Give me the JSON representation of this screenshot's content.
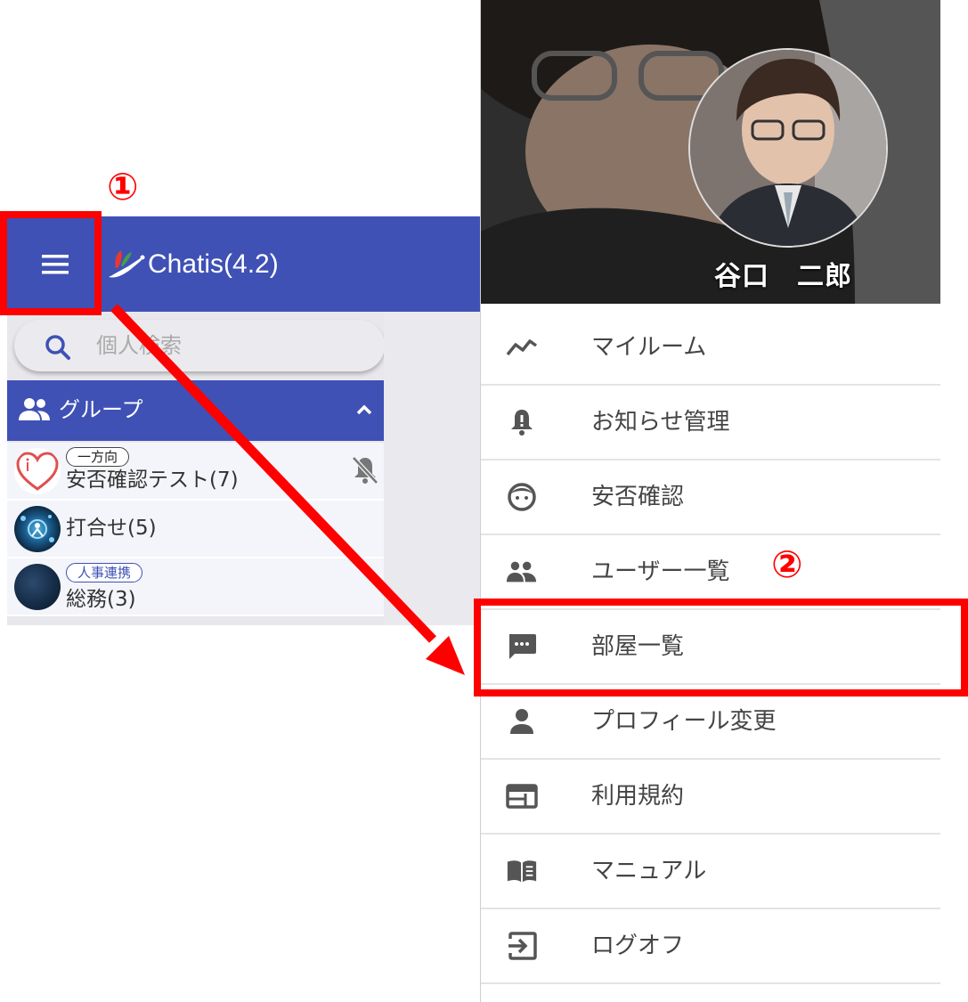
{
  "app": {
    "title": "Chatis(4.2)",
    "search_placeholder": "個人検索",
    "group_section_label": "グループ",
    "rooms": [
      {
        "badge": "一方向",
        "name": "安否確認テスト(7)",
        "muted": true
      },
      {
        "badge": "",
        "name": "打合せ(5)",
        "muted": false
      },
      {
        "badge": "人事連携",
        "name": "総務(3)",
        "muted": false
      }
    ]
  },
  "drawer": {
    "user_name": "谷口　二郎",
    "menu_items": [
      {
        "label": "マイルーム",
        "icon": "timeline-icon"
      },
      {
        "label": "お知らせ管理",
        "icon": "notification-bell-icon"
      },
      {
        "label": "安否確認",
        "icon": "face-icon"
      },
      {
        "label": "ユーザー一覧",
        "icon": "people-icon"
      },
      {
        "label": "部屋一覧",
        "icon": "chat-bubble-icon"
      },
      {
        "label": "プロフィール変更",
        "icon": "person-icon"
      },
      {
        "label": "利用規約",
        "icon": "web-icon"
      },
      {
        "label": "マニュアル",
        "icon": "book-icon"
      },
      {
        "label": "ログオフ",
        "icon": "exit-icon"
      }
    ]
  },
  "annotations": {
    "step1": "①",
    "step2": "②"
  },
  "colors": {
    "primary": "#3f51b5",
    "annotation_red": "#ff0000"
  }
}
